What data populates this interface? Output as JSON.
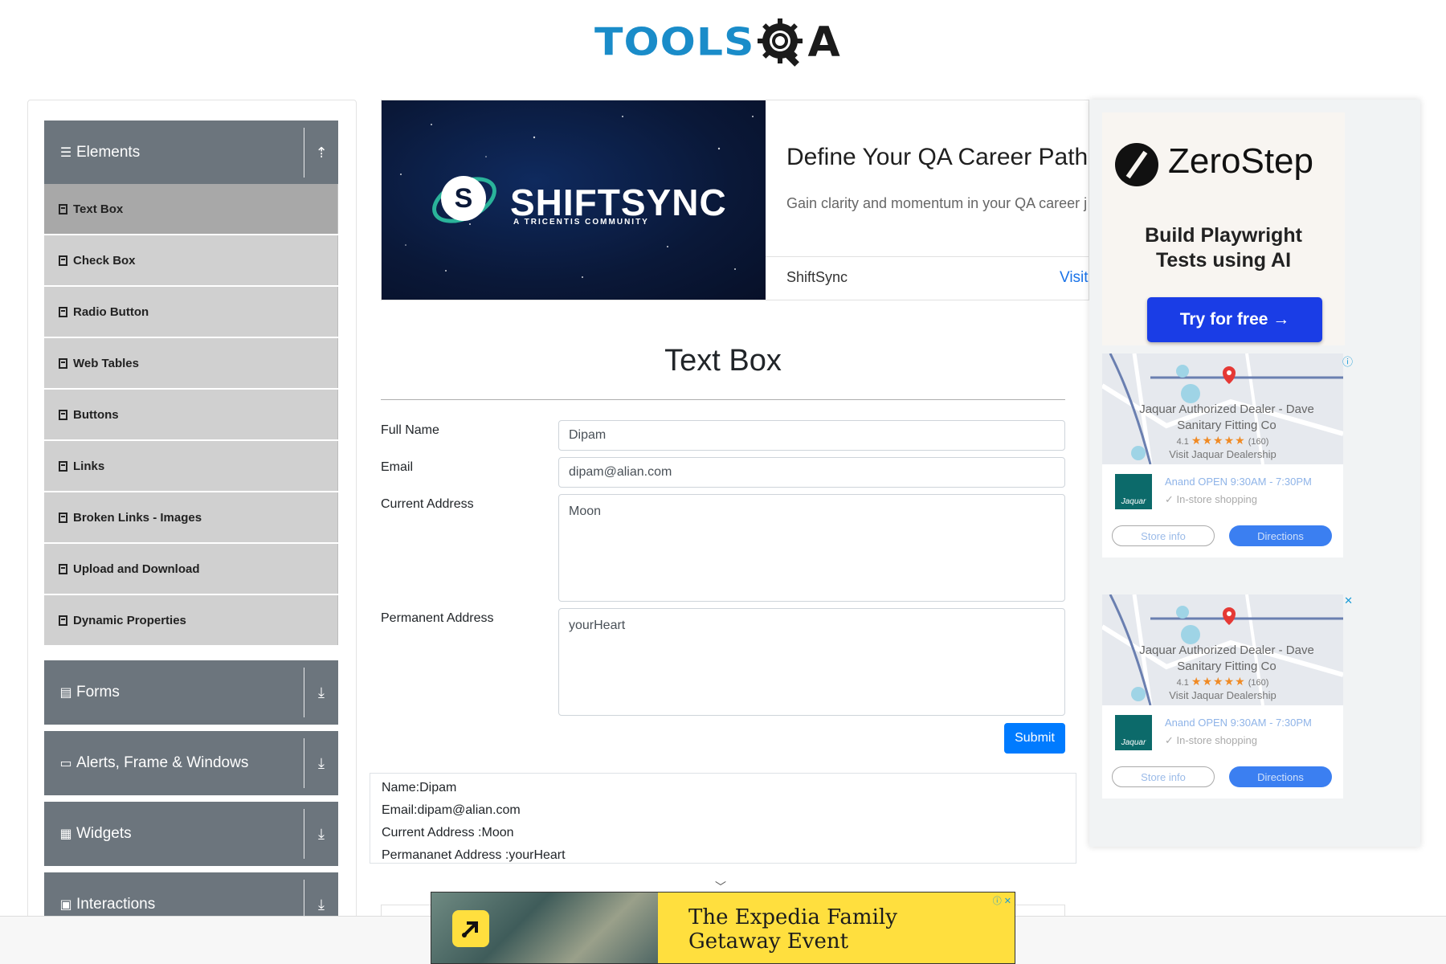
{
  "header": {
    "logo_text_left": "TOOLS",
    "logo_text_right": "A"
  },
  "sidebar": {
    "groups": [
      {
        "label": "Elements",
        "icon": "hamburger-icon",
        "arrow": "collapse-arrow-icon"
      },
      {
        "label": "Forms",
        "icon": "form-icon",
        "arrow": "expand-arrow-icon"
      },
      {
        "label": "Alerts, Frame & Windows",
        "icon": "window-icon",
        "arrow": "expand-arrow-icon"
      },
      {
        "label": "Widgets",
        "icon": "widgets-icon",
        "arrow": "expand-arrow-icon"
      },
      {
        "label": "Interactions",
        "icon": "interactions-icon",
        "arrow": "expand-arrow-icon"
      }
    ],
    "items": [
      {
        "label": "Text Box",
        "active": true
      },
      {
        "label": "Check Box"
      },
      {
        "label": "Radio Button"
      },
      {
        "label": "Web Tables"
      },
      {
        "label": "Buttons"
      },
      {
        "label": "Links"
      },
      {
        "label": "Broken Links - Images"
      },
      {
        "label": "Upload and Download"
      },
      {
        "label": "Dynamic Properties"
      }
    ]
  },
  "banner_ad": {
    "brand": "SHIFTSYNC",
    "brand_sub": "A TRICENTIS COMMUNITY",
    "logo_letter": "S",
    "title": "Define Your QA Career Path",
    "description": "Gain clarity and momentum in your QA career j",
    "advertiser": "ShiftSync",
    "cta": "Visit"
  },
  "main": {
    "title": "Text Box",
    "fields": {
      "full_name_label": "Full Name",
      "full_name_value": "Dipam",
      "email_label": "Email",
      "email_value": "dipam@alian.com",
      "current_address_label": "Current Address",
      "current_address_value": "Moon",
      "permanent_address_label": "Permanent Address",
      "permanent_address_value": "yourHeart"
    },
    "submit_label": "Submit",
    "output": {
      "name": "Name:Dipam",
      "email": "Email:dipam@alian.com",
      "current_address": "Current Address :Moon",
      "permanent_address": "Permananet Address :yourHeart"
    }
  },
  "right_ad": {
    "zerostep": {
      "name": "ZeroStep",
      "tagline_line1": "Build Playwright",
      "tagline_line2": "Tests using AI",
      "cta": "Try for free →"
    },
    "map_ads": [
      {
        "dealer_line1": "Jaquar Authorized Dealer - Dave",
        "dealer_line2": "Sanitary Fitting Co",
        "rating": "4.1",
        "stars": "★★★★★",
        "reviews": "(160)",
        "visit": "Visit Jaquar Dealership",
        "brand": "Jaquar",
        "open_text": "Anand  OPEN  9:30AM - 7:30PM",
        "shop_text": "✓ In-store shopping",
        "store_info": "Store info",
        "directions": "Directions"
      },
      {
        "dealer_line1": "Jaquar Authorized Dealer - Dave",
        "dealer_line2": "Sanitary Fitting Co",
        "rating": "4.1",
        "stars": "★★★★★",
        "reviews": "(160)",
        "visit": "Visit Jaquar Dealership",
        "brand": "Jaquar",
        "open_text": "Anand  OPEN  9:30AM - 7:30PM",
        "shop_text": "✓ In-store shopping",
        "store_info": "Store info",
        "directions": "Directions"
      }
    ]
  },
  "bottom_ad": {
    "line1": "The Expedia Family",
    "line2": "Getaway Event"
  },
  "colors": {
    "tools_blue": "#1a8cc9",
    "sidebar_header": "#6c757d",
    "menu_item": "#d0d0d0",
    "menu_item_active": "#a8a8a8",
    "submit_blue": "#007bff",
    "zerostep_button": "#1a3de6",
    "expedia_yellow": "#ffdf3e"
  }
}
